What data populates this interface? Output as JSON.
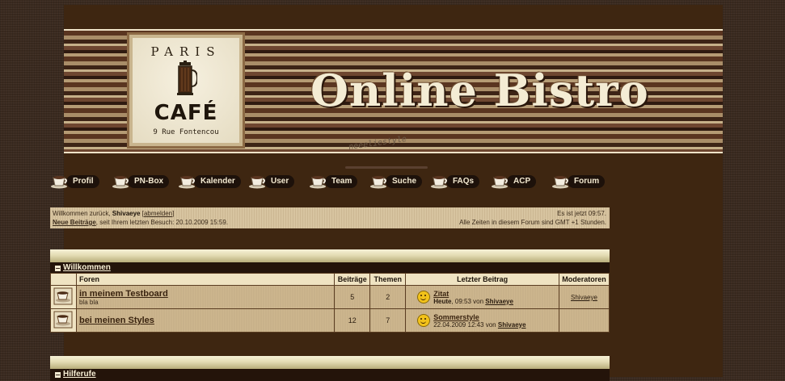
{
  "site": {
    "title": "Online Bistro",
    "stylename": "neeeliestyle",
    "logo": {
      "top_text": "PARIS",
      "main_text": "CAFÉ",
      "address": "9 Rue Fontencou"
    }
  },
  "nav": {
    "items": [
      {
        "label": "Profil",
        "icon": "coffee-cup-icon"
      },
      {
        "label": "PN-Box",
        "icon": "coffee-cup-icon"
      },
      {
        "label": "Kalender",
        "icon": "coffee-cup-icon"
      },
      {
        "label": "User",
        "icon": "coffee-cup-icon"
      },
      {
        "label": "Team",
        "icon": "coffee-cup-icon"
      },
      {
        "label": "Suche",
        "icon": "coffee-cup-icon"
      },
      {
        "label": "FAQs",
        "icon": "coffee-cup-icon"
      },
      {
        "label": "ACP",
        "icon": "coffee-cup-icon"
      },
      {
        "label": "Forum",
        "icon": "coffee-cup-icon"
      }
    ]
  },
  "info": {
    "welcome_prefix": "Willkommen zurück, ",
    "username": "Shivaeye",
    "logout": "abmelden",
    "new_posts": "Neue Beiträge",
    "last_visit": ", seit Ihrem letzten Besuch: 20.10.2009 15:59.",
    "current_time": "Es ist jetzt 09:57.",
    "timezone": "Alle Zeiten in diesem Forum sind GMT +1 Stunden."
  },
  "categories": [
    {
      "title": "Willkommen"
    },
    {
      "title": "Hilferufe"
    }
  ],
  "table": {
    "headers": {
      "forums": "Foren",
      "posts": "Beiträge",
      "threads": "Themen",
      "last_post": "Letzter Beitrag",
      "moderators": "Moderatoren"
    },
    "rows": [
      {
        "name": "in meinem Testboard",
        "description": "bla bla",
        "posts": "5",
        "threads": "2",
        "last_title": "Zitat",
        "last_date": "Heute",
        "last_time": ", 09:53 von ",
        "last_user": "Shivaeye",
        "moderator": "Shivaeye"
      },
      {
        "name": "bei meinen Styles",
        "description": "",
        "posts": "12",
        "threads": "7",
        "last_title": "Sommerstyle",
        "last_date": "22.04.2009",
        "last_time": " 12:43 von ",
        "last_user": "Shivaeye",
        "moderator": ""
      }
    ]
  },
  "colors": {
    "background": "#3a2a1f",
    "content": "#3e2611",
    "title_text": "#f4ecd4",
    "row_bg": "#cdb68e",
    "header_bg": "#efe3c2"
  }
}
